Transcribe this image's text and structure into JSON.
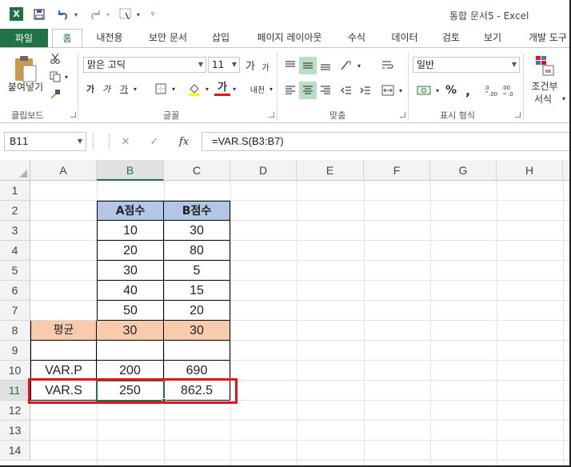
{
  "window": {
    "app_icon": "X",
    "title": "통합 문서5 - Excel"
  },
  "quick_access": {
    "save_icon": "save-icon",
    "undo_icon": "undo-icon",
    "redo_icon": "redo-icon",
    "touch_icon": "touch-mode-icon",
    "customize_icon": "customize-qat-icon"
  },
  "tabs": [
    "파일",
    "홈",
    "내전용",
    "보안 문서",
    "삽입",
    "페이지 레이아웃",
    "수식",
    "데이터",
    "검토",
    "보기",
    "개발 도구"
  ],
  "ribbon": {
    "clipboard": {
      "paste": "붙여넣기",
      "label": "클립보드"
    },
    "font": {
      "name": "맑은 고딕",
      "size": "11",
      "bold": "가",
      "italic": "가",
      "underline": "가",
      "grow": "가",
      "shrink": "가",
      "font_color_glyph": "가",
      "phonetic": "내천",
      "label": "글꼴"
    },
    "alignment": {
      "label": "맞춤"
    },
    "number": {
      "format": "일반",
      "percent": "%",
      "comma": ",",
      "label": "표시 형식"
    },
    "styles": {
      "conditional": "조건부",
      "conditional2": "서식"
    },
    "cut_icon": "scissors-icon",
    "copy_icon": "copy-icon",
    "brush_icon": "format-painter-icon"
  },
  "formula_bar": {
    "name_box": "B11",
    "cancel": "✕",
    "enter": "✓",
    "fx": "fx",
    "formula": "=VAR.S(B3:B7)"
  },
  "columns": [
    "A",
    "B",
    "C",
    "D",
    "E",
    "F",
    "G",
    "H"
  ],
  "rows": [
    "1",
    "2",
    "3",
    "4",
    "5",
    "6",
    "7",
    "8",
    "9",
    "10",
    "11",
    "12",
    "13",
    "14"
  ],
  "table": {
    "header": [
      "A점수",
      "B점수"
    ],
    "data": [
      [
        "10",
        "30"
      ],
      [
        "20",
        "80"
      ],
      [
        "30",
        "5"
      ],
      [
        "40",
        "15"
      ],
      [
        "50",
        "20"
      ]
    ],
    "avg_label": "평균",
    "avg": [
      "30",
      "30"
    ],
    "varp_label": "VAR.P",
    "varp": [
      "200",
      "690"
    ],
    "vars_label": "VAR.S",
    "vars": [
      "250",
      "862.5"
    ]
  },
  "colors": {
    "brand": "#217346",
    "header_fill": "#b4c6e7",
    "avg_fill": "#f8cbad",
    "highlight_box": "#e0141e"
  }
}
